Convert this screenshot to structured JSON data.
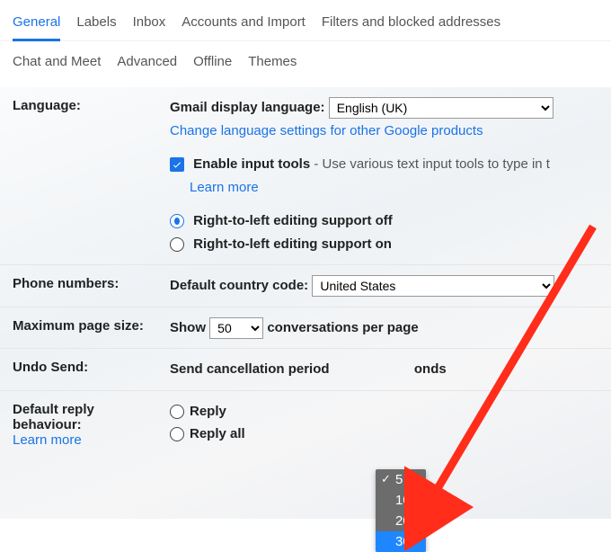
{
  "tabs": {
    "row1": [
      "General",
      "Labels",
      "Inbox",
      "Accounts and Import",
      "Filters and blocked addresses"
    ],
    "row2": [
      "Chat and Meet",
      "Advanced",
      "Offline",
      "Themes"
    ],
    "active": "General"
  },
  "language": {
    "label": "Language:",
    "display_label": "Gmail display language:",
    "display_value": "English (UK)",
    "change_link": "Change language settings for other Google products",
    "input_tools_label": "Enable input tools",
    "input_tools_desc": " - Use various text input tools to type in t",
    "learn_more": "Learn more",
    "rtl_off": "Right-to-left editing support off",
    "rtl_on": "Right-to-left editing support on"
  },
  "phone": {
    "label": "Phone numbers:",
    "code_label": "Default country code:",
    "code_value": "United States"
  },
  "page_size": {
    "label": "Maximum page size:",
    "show": "Show",
    "value": "50",
    "suffix": "conversations per page"
  },
  "undo": {
    "label": "Undo Send:",
    "prefix": "Send cancellation period",
    "suffix": "onds",
    "options": [
      "5",
      "10",
      "20",
      "30"
    ],
    "checked": "5",
    "highlighted": "30"
  },
  "reply": {
    "label_line1": "Default reply",
    "label_line2": "behaviour:",
    "learn_more": "Learn more",
    "opt1": "Reply",
    "opt2": "Reply all"
  }
}
